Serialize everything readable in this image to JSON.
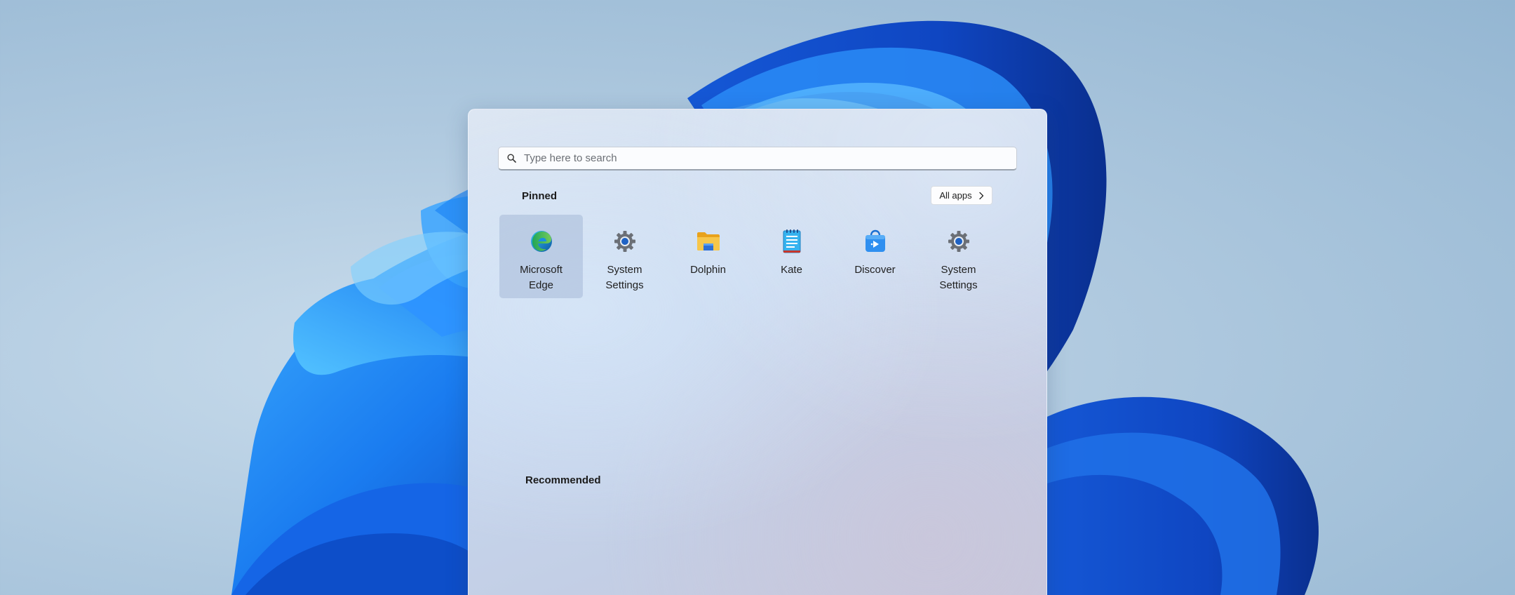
{
  "search": {
    "placeholder": "Type here to search"
  },
  "pinned": {
    "title": "Pinned",
    "all_apps_label": "All apps",
    "apps": [
      {
        "line1": "Microsoft",
        "line2": "Edge",
        "icon": "microsoft-edge-icon",
        "selected": true
      },
      {
        "line1": "System",
        "line2": "Settings",
        "icon": "gear-icon",
        "selected": false
      },
      {
        "line1": "Dolphin",
        "line2": "",
        "icon": "folder-icon",
        "selected": false
      },
      {
        "line1": "Kate",
        "line2": "",
        "icon": "notepad-icon",
        "selected": false
      },
      {
        "line1": "Discover",
        "line2": "",
        "icon": "shopping-bag-icon",
        "selected": false
      },
      {
        "line1": "System",
        "line2": "Settings",
        "icon": "gear-icon",
        "selected": false
      }
    ]
  },
  "recommended": {
    "title": "Recommended"
  },
  "colors": {
    "accent": "#0f6cbd",
    "wallpaper_blue": "#1a73e8"
  }
}
